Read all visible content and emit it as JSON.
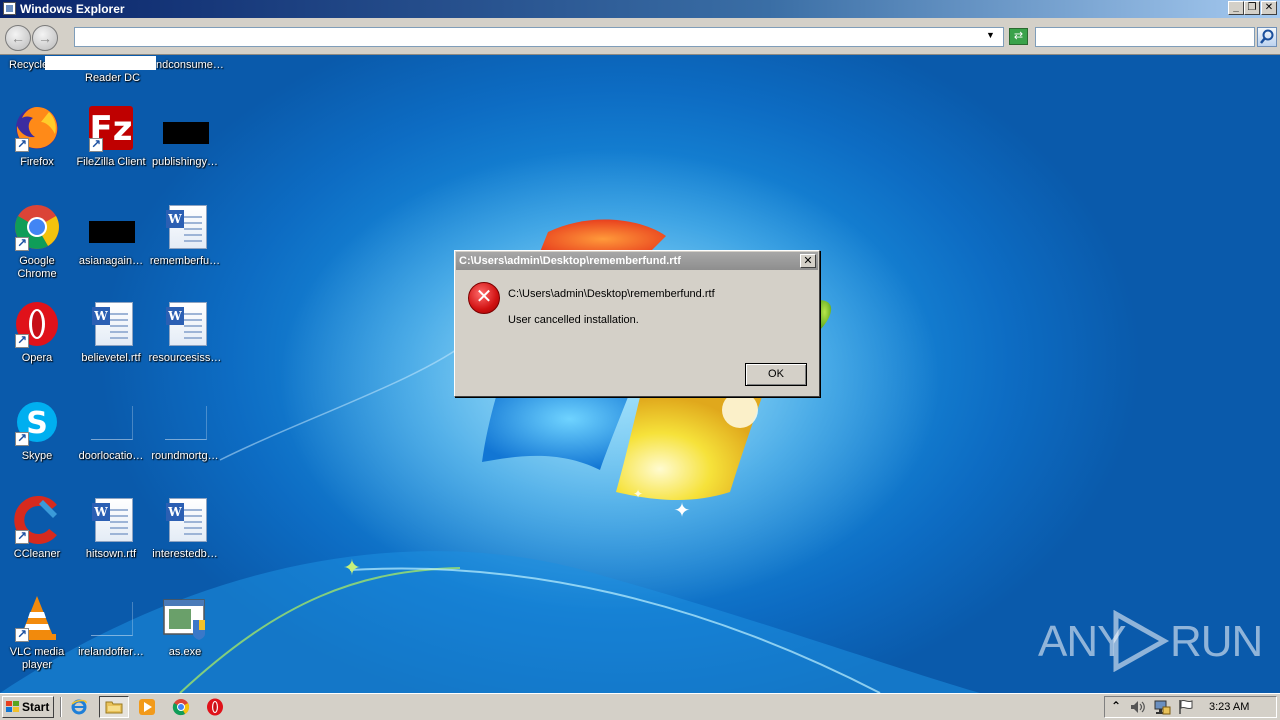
{
  "window": {
    "title": "Windows Explorer",
    "controls": [
      "_",
      "❐",
      "✕"
    ]
  },
  "explorer_bar": {
    "address_value": "",
    "search_value": "",
    "dropdown_glyph": "▼",
    "refresh_glyph": "⇄"
  },
  "desktop": {
    "partial_row": [
      {
        "label": "Recycle",
        "icon": "recycle-bin-icon"
      },
      {
        "label": "Reader DC",
        "icon": "acrobat-reader-icon"
      },
      {
        "label": "ndconsume…",
        "icon": "file-icon"
      }
    ],
    "icons": [
      {
        "label": "Firefox",
        "icon": "firefox-icon"
      },
      {
        "label": "FileZilla Client",
        "icon": "filezilla-icon"
      },
      {
        "label": "publishingy…",
        "icon": "redacted-file-icon"
      },
      {
        "label": "Google Chrome",
        "icon": "chrome-icon"
      },
      {
        "label": "asianagain…",
        "icon": "redacted-file-icon"
      },
      {
        "label": "rememberfu…",
        "icon": "word-document-icon"
      },
      {
        "label": "Opera",
        "icon": "opera-icon"
      },
      {
        "label": "believetel.rtf",
        "icon": "word-document-icon"
      },
      {
        "label": "resourcesiss…",
        "icon": "word-document-icon"
      },
      {
        "label": "Skype",
        "icon": "skype-icon"
      },
      {
        "label": "doorlocatio…",
        "icon": "blank-file-icon"
      },
      {
        "label": "roundmortg…",
        "icon": "blank-file-icon"
      },
      {
        "label": "CCleaner",
        "icon": "ccleaner-icon"
      },
      {
        "label": "hitsown.rtf",
        "icon": "word-document-icon"
      },
      {
        "label": "interestedb…",
        "icon": "word-document-icon"
      },
      {
        "label": "VLC media player",
        "icon": "vlc-icon"
      },
      {
        "label": "irelandoffer…",
        "icon": "blank-file-icon"
      },
      {
        "label": "as.exe",
        "icon": "exe-file-icon"
      }
    ]
  },
  "dialog": {
    "title": "C:\\Users\\admin\\Desktop\\rememberfund.rtf",
    "close_glyph": "✕",
    "path_text": "C:\\Users\\admin\\Desktop\\rememberfund.rtf",
    "message": "User cancelled installation.",
    "error_glyph": "✕",
    "ok_label": "OK"
  },
  "watermark": {
    "left": "ANY",
    "right": "RUN"
  },
  "taskbar": {
    "start_label": "Start",
    "tray_arrow": "⌃",
    "clock": "3:23 AM"
  },
  "colors": {
    "desktop_blue": "#0d6cc3",
    "dialog_gray": "#d4d0c8",
    "error_red": "#d11212",
    "titlebar_blue": "#0a246a"
  }
}
